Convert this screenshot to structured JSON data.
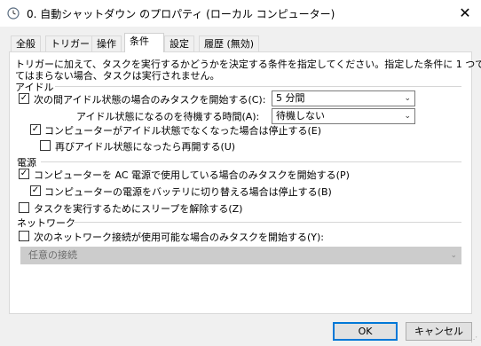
{
  "window": {
    "title": "0. 自動シャットダウン のプロパティ (ローカル コンピューター)"
  },
  "tabs": [
    "全般",
    "トリガー",
    "操作",
    "条件",
    "設定",
    "履歴 (無効)"
  ],
  "conditions": {
    "description_line1": "トリガーに加えて、タスクを実行するかどうかを決定する条件を指定してください。指定した条件に 1 つでもあ",
    "description_line2": "てはまらない場合、タスクは実行されません。",
    "idle": {
      "group": "アイドル",
      "start_only_if_idle": "次の間アイドル状態の場合のみタスクを開始する(C):",
      "idle_duration_value": "5 分間",
      "wait_for_idle_label": "アイドル状態になるのを待機する時間(A):",
      "wait_for_idle_value": "待機しない",
      "stop_if_not_idle": "コンピューターがアイドル状態でなくなった場合は停止する(E)",
      "restart_if_idle": "再びアイドル状態になったら再開する(U)"
    },
    "power": {
      "group": "電源",
      "ac_only": "コンピューターを AC 電源で使用している場合のみタスクを開始する(P)",
      "stop_on_battery": "コンピューターの電源をバッテリに切り替える場合は停止する(B)",
      "wake_to_run": "タスクを実行するためにスリープを解除する(Z)"
    },
    "network": {
      "group": "ネットワーク",
      "start_if_network": "次のネットワーク接続が使用可能な場合のみタスクを開始する(Y):",
      "connection_value": "任意の接続"
    }
  },
  "buttons": {
    "ok": "OK",
    "cancel": "キャンセル"
  },
  "checkmark": "✓"
}
